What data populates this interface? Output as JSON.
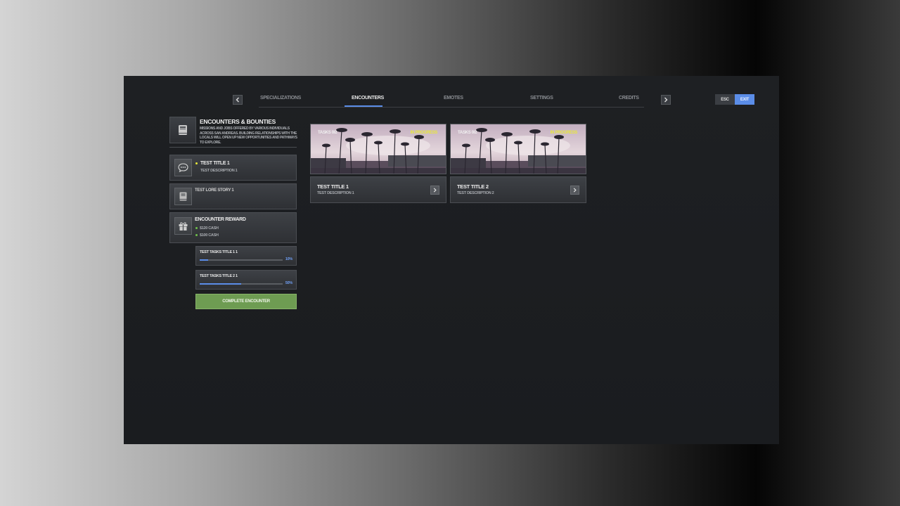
{
  "nav": {
    "tabs": [
      {
        "label": "SPECIALIZATIONS",
        "active": false
      },
      {
        "label": "ENCOUNTERS",
        "active": true
      },
      {
        "label": "EMOTES",
        "active": false
      },
      {
        "label": "SETTINGS",
        "active": false
      },
      {
        "label": "CREDITS",
        "active": false
      }
    ],
    "esc_label": "ESC",
    "exit_label": "EXIT",
    "accent": "#5b8de8"
  },
  "header": {
    "title": "ENCOUNTERS & BOUNTIES",
    "description": "MISSIONS AND JOBS OFFERED BY VARIOUS INDIVIDUALS ACROSS SAN ANDREAS. BUILDING RELATIONSHIPS WITH THE LOCALS WILL OPEN UP NEW OPPORTUNITIES AND PATHWAYS TO EXPLORE.",
    "icon": "book-icon"
  },
  "selected": {
    "title": "TEST TITLE 1",
    "description": "TEST DESCRIPTION 1",
    "icon": "chat-icon",
    "dot_color": "#e8e83a"
  },
  "lore": {
    "title": "TEST LORE STORY 1",
    "icon": "book-icon"
  },
  "reward": {
    "title": "ENCOUNTER REWARD",
    "items": [
      "$120 CASH",
      "$100 CASH"
    ],
    "icon": "gift-icon",
    "dot_color": "#6ec04a"
  },
  "tasks": [
    {
      "title": "TEST TASKS TITLE 1 1",
      "progress": 10,
      "label": "10%"
    },
    {
      "title": "TEST TASKS TITLE 2 1",
      "progress": 50,
      "label": "50%"
    }
  ],
  "complete_label": "COMPLETE ENCOUNTER",
  "encounters": [
    {
      "tasks": "TASKS 0/2",
      "status": "IN PROGRESS",
      "title": "TEST TITLE 1",
      "description": "TEST DESCRIPTION 1"
    },
    {
      "tasks": "TASKS 0/2",
      "status": "IN PROGRESS",
      "title": "TEST TITLE 2",
      "description": "TEST DESCRIPTION 2"
    }
  ],
  "status_color": "#e8e83a"
}
